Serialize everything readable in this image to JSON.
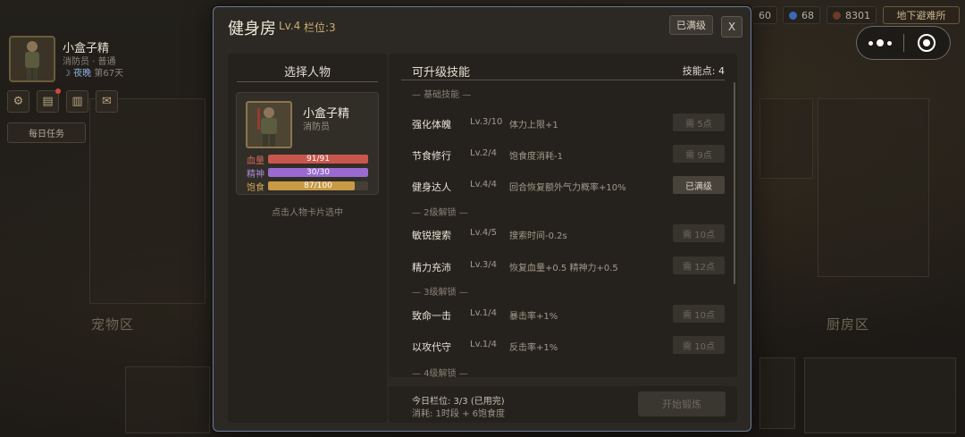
{
  "hud": {
    "player_name": "小盒子精",
    "player_sub": "消防员 · 普通",
    "time_icon": "moon-icon",
    "time_label": "夜晚",
    "day_count": "第67天",
    "daily_task_label": "每日任务",
    "res_a": "60",
    "res_b": "68",
    "res_c": "8301",
    "shelter_button": "地下避难所"
  },
  "background": {
    "zone_left": "宠物区",
    "zone_right": "厨房区"
  },
  "modal": {
    "title": "健身房",
    "level": "Lv.4",
    "slots": "栏位:3",
    "maxed_tag": "已满级",
    "close_label": "X"
  },
  "left": {
    "title": "选择人物",
    "character": {
      "name": "小盒子精",
      "role": "消防员",
      "stats": [
        {
          "label": "血量",
          "value": "91/91",
          "fraction": 1.0,
          "color": "#c9564c",
          "label_color": "#d4685c"
        },
        {
          "label": "精神",
          "value": "30/30",
          "fraction": 1.0,
          "color": "#9a6ad0",
          "label_color": "#a98ad8"
        },
        {
          "label": "饱食",
          "value": "87/100",
          "fraction": 0.87,
          "color": "#c99a45",
          "label_color": "#d0a55a"
        }
      ]
    },
    "hint": "点击人物卡片选中"
  },
  "right": {
    "title": "可升级技能",
    "skill_points": "技能点: 4",
    "sections": [
      {
        "label": "— 基础技能 —"
      },
      {
        "label": "— 2级解锁 —"
      },
      {
        "label": "— 3级解锁 —"
      },
      {
        "label": "— 4级解锁 —"
      }
    ],
    "skills": [
      {
        "name": "强化体魄",
        "level": "Lv.3/10",
        "desc": "体力上限+1",
        "button": "需 5点",
        "maxed": false
      },
      {
        "name": "节食修行",
        "level": "Lv.2/4",
        "desc": "饱食度消耗-1",
        "button": "需 9点",
        "maxed": false
      },
      {
        "name": "健身达人",
        "level": "Lv.4/4",
        "desc": "回合恢复额外气力概率+10%",
        "button": "已满级",
        "maxed": true
      },
      {
        "name": "敏锐搜索",
        "level": "Lv.4/5",
        "desc": "搜索时间-0.2s",
        "button": "需 10点",
        "maxed": false
      },
      {
        "name": "精力充沛",
        "level": "Lv.3/4",
        "desc": "恢复血量+0.5 精神力+0.5",
        "button": "需 12点",
        "maxed": false
      },
      {
        "name": "致命一击",
        "level": "Lv.1/4",
        "desc": "暴击率+1%",
        "button": "需 10点",
        "maxed": false
      },
      {
        "name": "以攻代守",
        "level": "Lv.1/4",
        "desc": "反击率+1%",
        "button": "需 10点",
        "maxed": false
      }
    ]
  },
  "footer": {
    "slots_text": "今日栏位: 3/3 (已用完)",
    "cost_text": "消耗: 1时段 + 6饱食度",
    "start_button": "开始锻炼"
  }
}
